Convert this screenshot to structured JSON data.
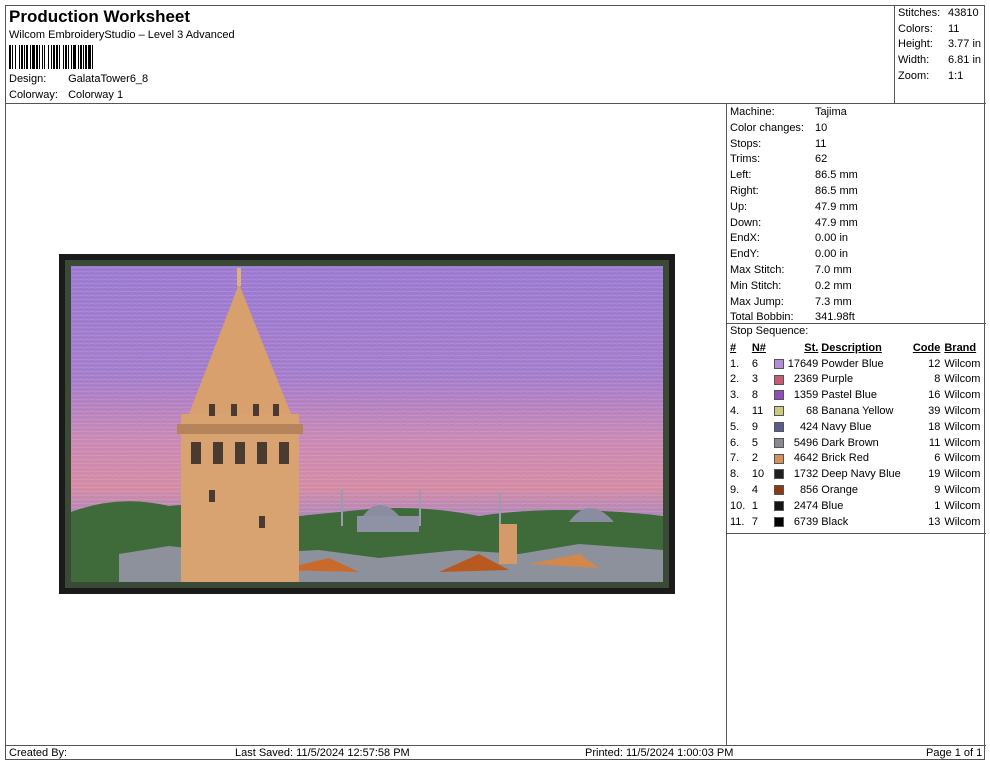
{
  "header": {
    "title": "Production Worksheet",
    "subtitle": "Wilcom EmbroideryStudio – Level 3 Advanced",
    "design_label": "Design:",
    "design_value": "GalataTower6_8",
    "colorway_label": "Colorway:",
    "colorway_value": "Colorway 1"
  },
  "summary": [
    {
      "label": "Stitches:",
      "value": "43810"
    },
    {
      "label": "Colors:",
      "value": "11"
    },
    {
      "label": "Height:",
      "value": "3.77 in"
    },
    {
      "label": "Width:",
      "value": "6.81 in"
    },
    {
      "label": "Zoom:",
      "value": "1:1"
    }
  ],
  "stats": [
    {
      "label": "Machine:",
      "value": "Tajima"
    },
    {
      "label": "Color changes:",
      "value": "10"
    },
    {
      "label": "Stops:",
      "value": "11"
    },
    {
      "label": "Trims:",
      "value": "62"
    },
    {
      "label": "Left:",
      "value": "86.5 mm"
    },
    {
      "label": "Right:",
      "value": "86.5 mm"
    },
    {
      "label": "Up:",
      "value": "47.9 mm"
    },
    {
      "label": "Down:",
      "value": "47.9 mm"
    },
    {
      "label": "EndX:",
      "value": "0.00 in"
    },
    {
      "label": "EndY:",
      "value": "0.00 in"
    },
    {
      "label": "Max Stitch:",
      "value": "7.0 mm"
    },
    {
      "label": "Min Stitch:",
      "value": "0.2 mm"
    },
    {
      "label": "Max Jump:",
      "value": "7.3 mm"
    },
    {
      "label": "Total Bobbin:",
      "value": "341.98ft"
    }
  ],
  "stop_sequence": {
    "title": "Stop Sequence:",
    "headers": {
      "num": "#",
      "n": "N#",
      "st": "St.",
      "desc": "Description",
      "code": "Code",
      "brand": "Brand"
    },
    "rows": [
      {
        "num": "1.",
        "n": "6",
        "color": "#b48bd6",
        "st": "17649",
        "desc": "Powder Blue",
        "code": "12",
        "brand": "Wilcom"
      },
      {
        "num": "2.",
        "n": "3",
        "color": "#c85a78",
        "st": "2369",
        "desc": "Purple",
        "code": "8",
        "brand": "Wilcom"
      },
      {
        "num": "3.",
        "n": "8",
        "color": "#8e4fbd",
        "st": "1359",
        "desc": "Pastel Blue",
        "code": "16",
        "brand": "Wilcom"
      },
      {
        "num": "4.",
        "n": "11",
        "color": "#cfc97a",
        "st": "68",
        "desc": "Banana Yellow",
        "code": "39",
        "brand": "Wilcom"
      },
      {
        "num": "5.",
        "n": "9",
        "color": "#5c5c8a",
        "st": "424",
        "desc": "Navy Blue",
        "code": "18",
        "brand": "Wilcom"
      },
      {
        "num": "6.",
        "n": "5",
        "color": "#8a8a94",
        "st": "5496",
        "desc": "Dark Brown",
        "code": "11",
        "brand": "Wilcom"
      },
      {
        "num": "7.",
        "n": "2",
        "color": "#d8905a",
        "st": "4642",
        "desc": "Brick Red",
        "code": "6",
        "brand": "Wilcom"
      },
      {
        "num": "8.",
        "n": "10",
        "color": "#1e1e1e",
        "st": "1732",
        "desc": "Deep Navy Blue",
        "code": "19",
        "brand": "Wilcom"
      },
      {
        "num": "9.",
        "n": "4",
        "color": "#8a3a12",
        "st": "856",
        "desc": "Orange",
        "code": "9",
        "brand": "Wilcom"
      },
      {
        "num": "10.",
        "n": "1",
        "color": "#141414",
        "st": "2474",
        "desc": "Blue",
        "code": "1",
        "brand": "Wilcom"
      },
      {
        "num": "11.",
        "n": "7",
        "color": "#000000",
        "st": "6739",
        "desc": "Black",
        "code": "13",
        "brand": "Wilcom"
      }
    ]
  },
  "footer": {
    "created": "Created By:",
    "saved": "Last Saved: 11/5/2024 12:57:58 PM",
    "printed": "Printed: 11/5/2024 1:00:03 PM",
    "page": "Page 1 of 1"
  }
}
